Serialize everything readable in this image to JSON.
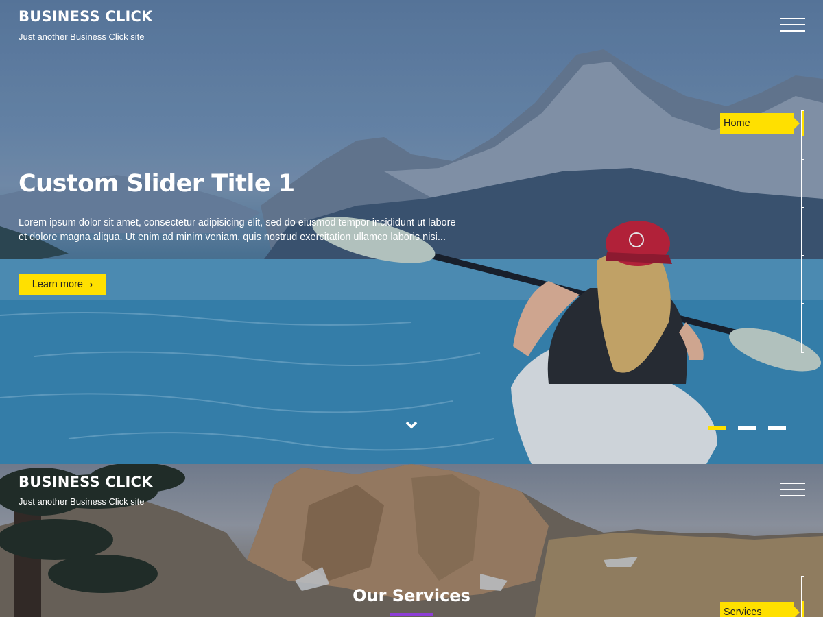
{
  "site": {
    "title": "BUSINESS CLICK",
    "tagline": "Just another Business Click site"
  },
  "hero": {
    "slide_title": "Custom Slider Title 1",
    "slide_text": "Lorem ipsum dolor sit amet, consectetur adipisicing elit, sed do eiusmod tempor incididunt ut labore et dolore magna aliqua. Ut enim ad minim veniam, quis nostrud exercitation ullamco laboris nisi...",
    "button_label": "Learn more",
    "button_icon": "chevron-right-icon",
    "scroll_icon": "chevron-down-icon",
    "side_nav_label": "Home",
    "slides": [
      {
        "active": true
      },
      {
        "active": false
      },
      {
        "active": false
      }
    ]
  },
  "services": {
    "title": "Our Services",
    "side_nav_label": "Services"
  },
  "colors": {
    "accent": "#ffe000",
    "underline": "#8e3fd6",
    "text": "#ffffff"
  }
}
